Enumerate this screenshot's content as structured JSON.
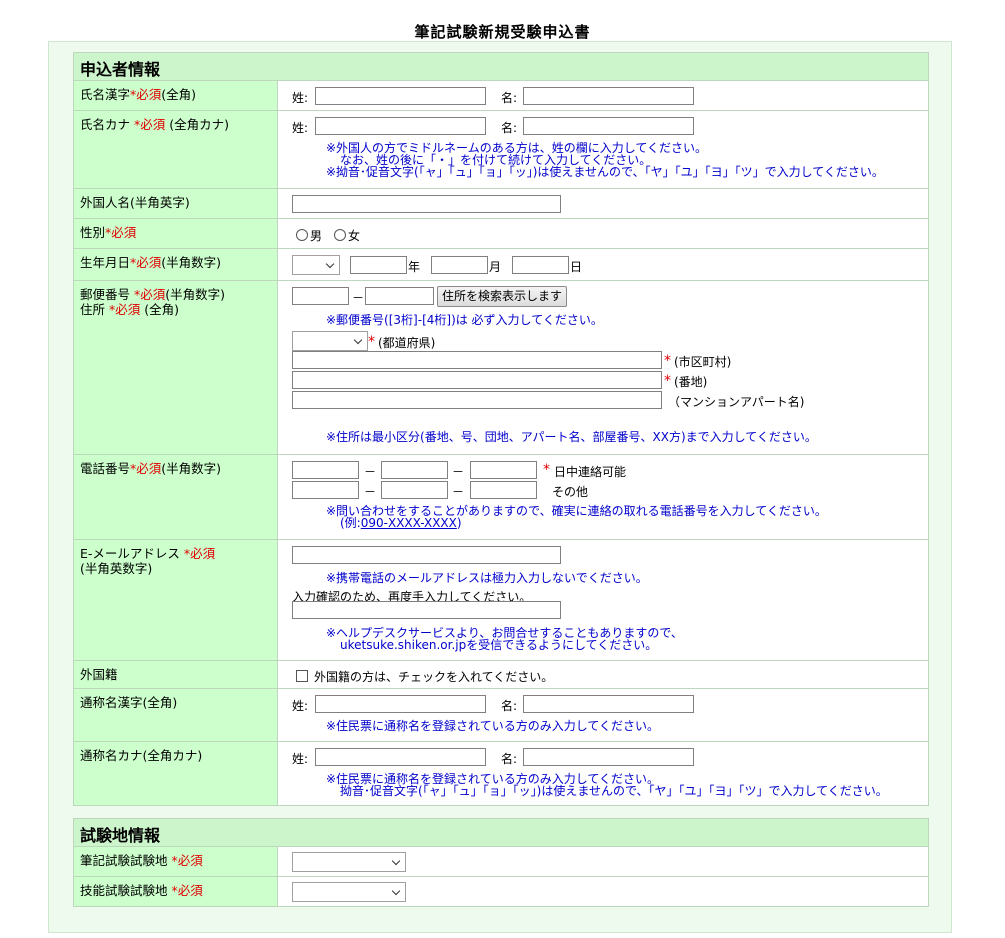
{
  "title": "筆記試験新規受験申込書",
  "applicant": {
    "header": "申込者情報",
    "req": "*必須",
    "name_kanji": {
      "label": "氏名漢字",
      "qual": "(全角)",
      "sei": "姓:",
      "mei": "名:"
    },
    "name_kana": {
      "label": "氏名カナ",
      "qual": " (全角カナ)",
      "sei": "姓:",
      "mei": "名:",
      "note1": "※外国人の方でミドルネームのある方は、姓の欄に入力してください。",
      "note2": "なお、姓の後に「・」を付けて続けて入力してください。",
      "note3": "※拗音･促音文字(「ャ」「ュ」「ョ」「ッ」)は使えませんので、「ヤ」「ユ」「ヨ」「ツ」で入力してください。"
    },
    "foreign_name": {
      "label": "外国人名(半角英字)"
    },
    "gender": {
      "label": "性別",
      "male": "男",
      "female": "女"
    },
    "birthdate": {
      "label": "生年月日",
      "qual": "(半角数字)",
      "year": "年",
      "month": "月",
      "day": "日"
    },
    "address": {
      "zip_label": "郵便番号",
      "zip_qual": "(半角数字)",
      "addr_label": "住所",
      "addr_qual": " (全角)",
      "dash": "－",
      "search_button": "住所を検索表示します",
      "zip_note": "※郵便番号([3桁]-[4桁])は 必ず入力してください。",
      "star": "*",
      "pref": "(都道府県)",
      "city": "(市区町村)",
      "banchi": "(番地)",
      "building": "（マンションアパート名)",
      "addr_note": "※住所は最小区分(番地、号、団地、アパート名、部屋番号、XX方)まで入力してください。"
    },
    "phone": {
      "label": "電話番号",
      "qual": "(半角数字)",
      "dash": "－",
      "daytime": "日中連絡可能",
      "other": "その他",
      "note1": "※問い合わせをすることがありますので、確実に連絡の取れる電話番号を入力してください。",
      "example_prefix": "(例:",
      "example": "090-XXXX-XXXX",
      "example_suffix": ")"
    },
    "email": {
      "label": "E-メールアドレス",
      "qual": "(半角英数字)",
      "note1": "※携帯電話のメールアドレスは極力入力しないでください。",
      "confirm": "入力確認のため、再度手入力してください。",
      "note2": "※ヘルプデスクサービスより、お問合せすることもありますので、",
      "note3": "uketsuke.shiken.or.jpを受信できるようにしてください。"
    },
    "nationality": {
      "label": "外国籍",
      "check_text": "外国籍の方は、チェックを入れてください。"
    },
    "alias_kanji": {
      "label": "通称名漢字(全角)",
      "sei": "姓:",
      "mei": "名:",
      "note": "※住民票に通称名を登録されている方のみ入力してください。"
    },
    "alias_kana": {
      "label": "通称名カナ(全角カナ)",
      "sei": "姓:",
      "mei": "名:",
      "note1": "※住民票に通称名を登録されている方のみ入力してください。",
      "note2": "拗音･促音文字(「ャ」「ュ」「ョ」「ッ」)は使えませんので、「ヤ」「ユ」「ヨ」「ツ」で入力してください。"
    }
  },
  "exam": {
    "header": "試験地情報",
    "written": {
      "label": "筆記試験試験地"
    },
    "practical": {
      "label": "技能試験試験地"
    }
  }
}
